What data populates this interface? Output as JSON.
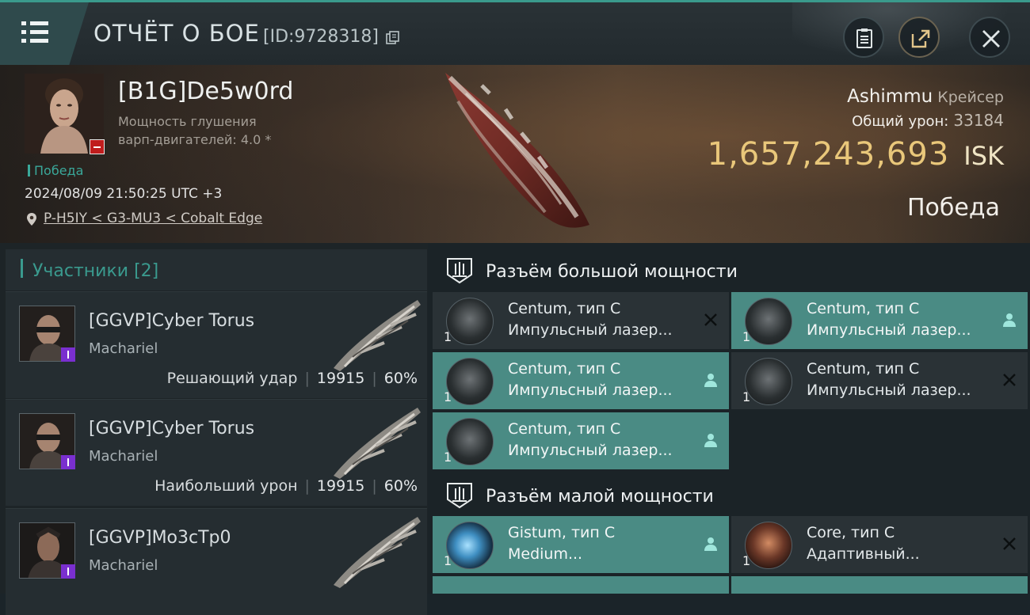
{
  "header": {
    "title": "ОТЧЁТ О БОЕ",
    "report_id": "[ID:9728318]",
    "icons": [
      "menu-icon",
      "copy-icon",
      "clipboard-icon",
      "share-icon",
      "close-icon"
    ]
  },
  "banner": {
    "pilot_name": "[B1G]De5w0rd",
    "warp_line1": "Мощность глушения",
    "warp_line2": "варп-двигателей: 4.0 *",
    "status_tag": "Победа",
    "timestamp": "2024/08/09 21:50:25 UTC +3",
    "location": "P-H5IY < G3-MU3 < Cobalt Edge",
    "victim_ship": "Ashimmu",
    "victim_class": "Крейсер",
    "total_damage_label": "Общий урон:",
    "total_damage_value": "33184",
    "isk_value": "1,657,243,693",
    "isk_unit": "ISK",
    "result": "Победа"
  },
  "participants": {
    "title": "Участники",
    "count": "[2]",
    "rows": [
      {
        "name": "[GGVP]Cyber Torus",
        "ship": "Machariel",
        "label": "Решающий удар",
        "damage": "19915",
        "percent": "60%"
      },
      {
        "name": "[GGVP]Cyber Torus",
        "ship": "Machariel",
        "label": "Наибольший урон",
        "damage": "19915",
        "percent": "60%"
      },
      {
        "name": "[GGVP]Mo3cTp0",
        "ship": "Machariel",
        "label": "",
        "damage": "",
        "percent": ""
      }
    ]
  },
  "modules": {
    "high_slot_title": "Разъём большой мощности",
    "low_slot_title": "Разъём малой мощности",
    "high": [
      {
        "name": "Centum, тип C",
        "desc": "Импульсный лазер...",
        "qty": "1",
        "state": "destroyed"
      },
      {
        "name": "Centum, тип C",
        "desc": "Импульсный лазер...",
        "qty": "1",
        "state": "dropped"
      },
      {
        "name": "Centum, тип C",
        "desc": "Импульсный лазер...",
        "qty": "1",
        "state": "dropped"
      },
      {
        "name": "Centum, тип C",
        "desc": "Импульсный лазер...",
        "qty": "1",
        "state": "destroyed"
      },
      {
        "name": "Centum, тип C",
        "desc": "Импульсный лазер...",
        "qty": "1",
        "state": "dropped"
      }
    ],
    "low": [
      {
        "name": "Gistum, тип C",
        "desc": "Medium...",
        "qty": "1",
        "state": "dropped"
      },
      {
        "name": "Core, тип C",
        "desc": "Адаптивный...",
        "qty": "1",
        "state": "destroyed"
      }
    ],
    "colors": {
      "dropped": "#4a8b84",
      "destroyed": "#2a3236",
      "accent": "#3a9a8e",
      "isk": "#e9c77a"
    }
  }
}
